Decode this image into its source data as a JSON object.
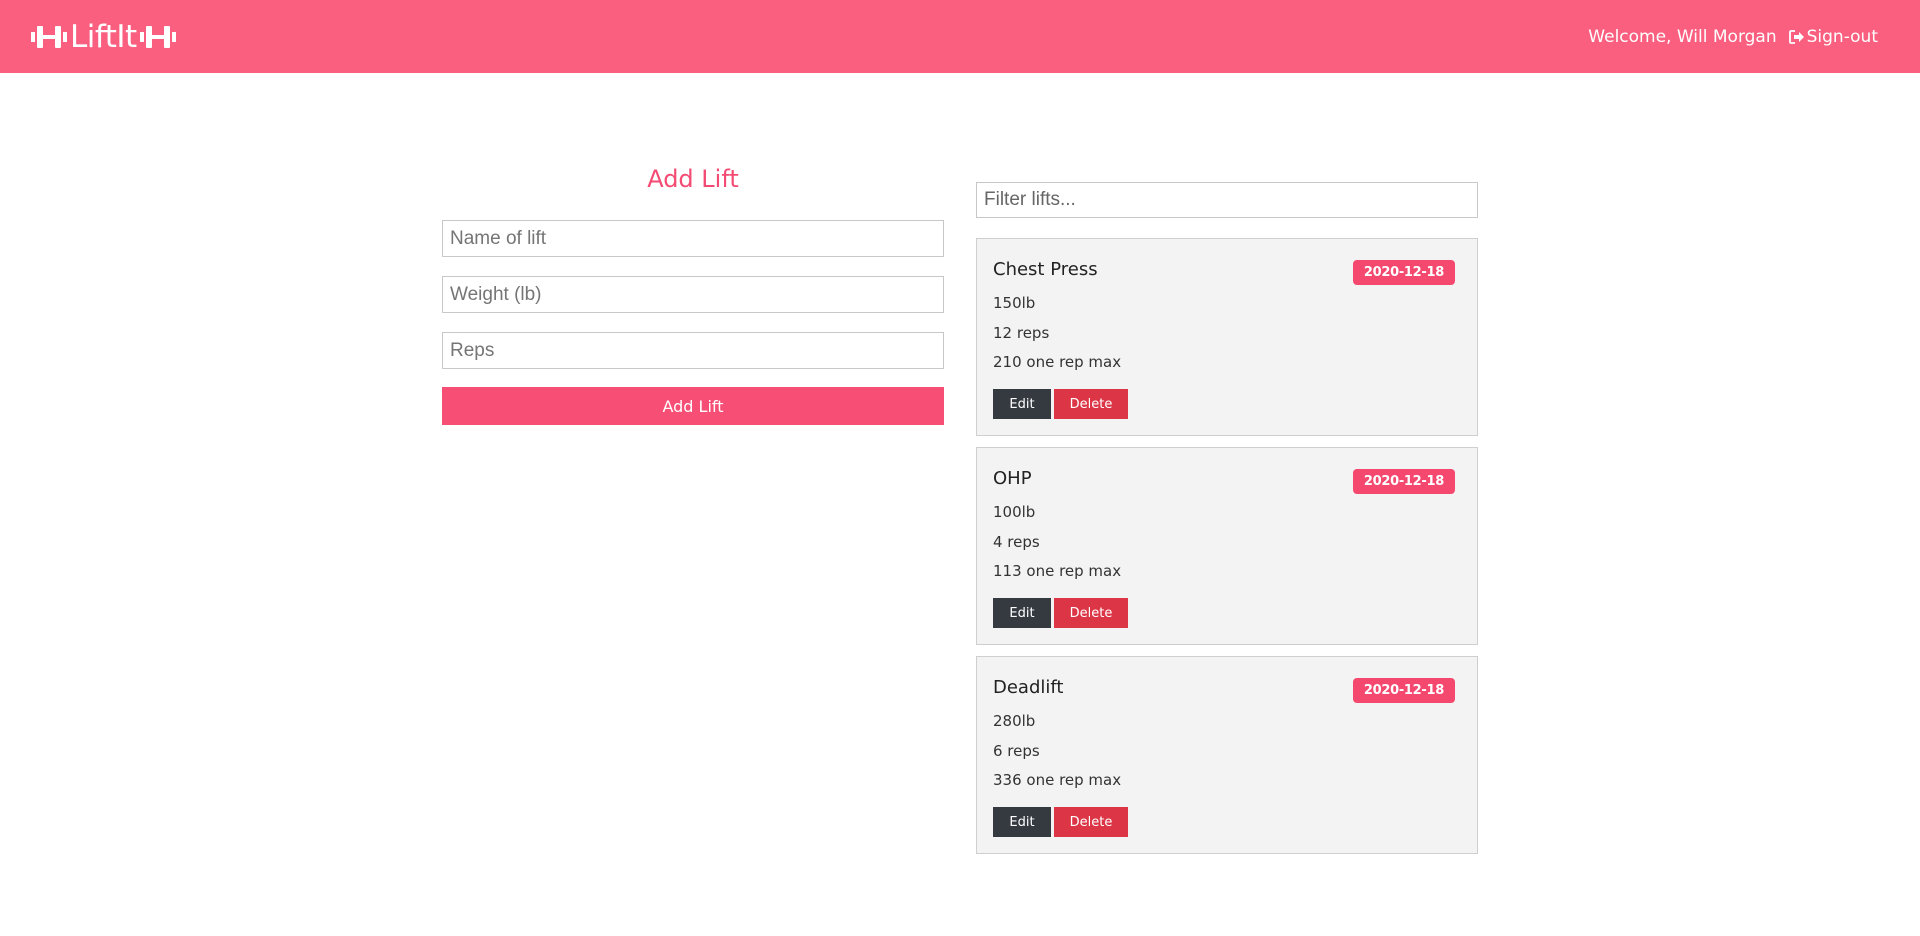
{
  "header": {
    "brand": "LiftIt",
    "welcome": "Welcome, Will Morgan",
    "signout_label": "Sign-out",
    "bg_color": "#fa5f7f"
  },
  "form": {
    "title": "Add Lift",
    "name_placeholder": "Name of lift",
    "weight_placeholder": "Weight (lb)",
    "reps_placeholder": "Reps",
    "submit_label": "Add Lift"
  },
  "filter": {
    "placeholder": "Filter lifts..."
  },
  "lifts": [
    {
      "name": "Chest Press",
      "date": "2020-12-18",
      "weight": "150lb",
      "reps": "12 reps",
      "max": "210 one rep max",
      "edit_label": "Edit",
      "delete_label": "Delete"
    },
    {
      "name": "OHP",
      "date": "2020-12-18",
      "weight": "100lb",
      "reps": "4 reps",
      "max": "113 one rep max",
      "edit_label": "Edit",
      "delete_label": "Delete"
    },
    {
      "name": "Deadlift",
      "date": "2020-12-18",
      "weight": "280lb",
      "reps": "6 reps",
      "max": "336 one rep max",
      "edit_label": "Edit",
      "delete_label": "Delete"
    }
  ],
  "icons": {
    "brand": "dumbbell-icon",
    "signout": "sign-out-icon"
  }
}
